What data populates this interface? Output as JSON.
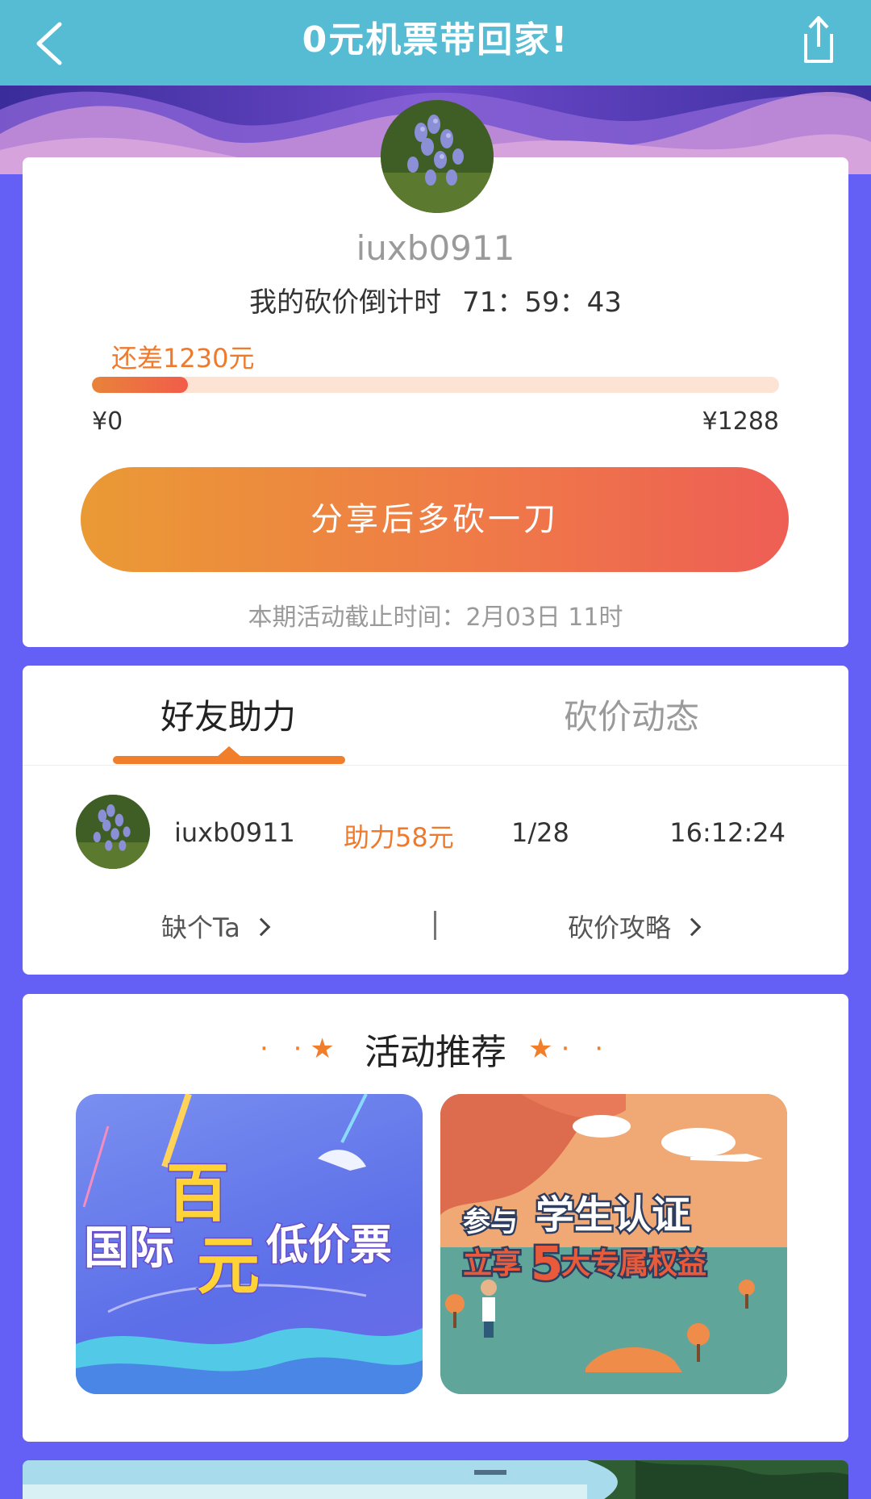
{
  "header": {
    "title": "0元机票带回家!"
  },
  "profile": {
    "username": "iuxb0911",
    "countdown_label": "我的砍价倒计时",
    "countdown_time": "71：59：43",
    "remaining_text": "还差1230元",
    "progress_fraction": 0.045,
    "price_min": "¥0",
    "price_max": "¥1288",
    "share_button_label": "分享后多砍一刀",
    "deadline_text": "本期活动截止时间：2月03日 11时"
  },
  "tabs": [
    {
      "label": "好友助力",
      "active": true
    },
    {
      "label": "砍价动态",
      "active": false
    }
  ],
  "helpers": [
    {
      "name": "iuxb0911",
      "amount": "助力58元",
      "rank": "1/28",
      "time": "16:12:24"
    }
  ],
  "links": {
    "missing_label": "缺个Ta",
    "guide_label": "砍价攻略"
  },
  "recommend": {
    "title": "活动推荐",
    "promos": [
      {
        "line1": "国际",
        "big1": "百",
        "big2": "元",
        "line2": "低价票"
      },
      {
        "prefix": "参与",
        "main": "学生认证",
        "line2a": "立享",
        "num": "5",
        "line2b": "大专属权益"
      }
    ]
  },
  "colors": {
    "accent": "#f07e2a",
    "navbar": "#55bcd4",
    "background": "#6460f5"
  },
  "icons": {
    "back": "chevron-left-icon",
    "share": "share-icon",
    "chevron": "chevron-right-icon",
    "star": "star-icon"
  }
}
